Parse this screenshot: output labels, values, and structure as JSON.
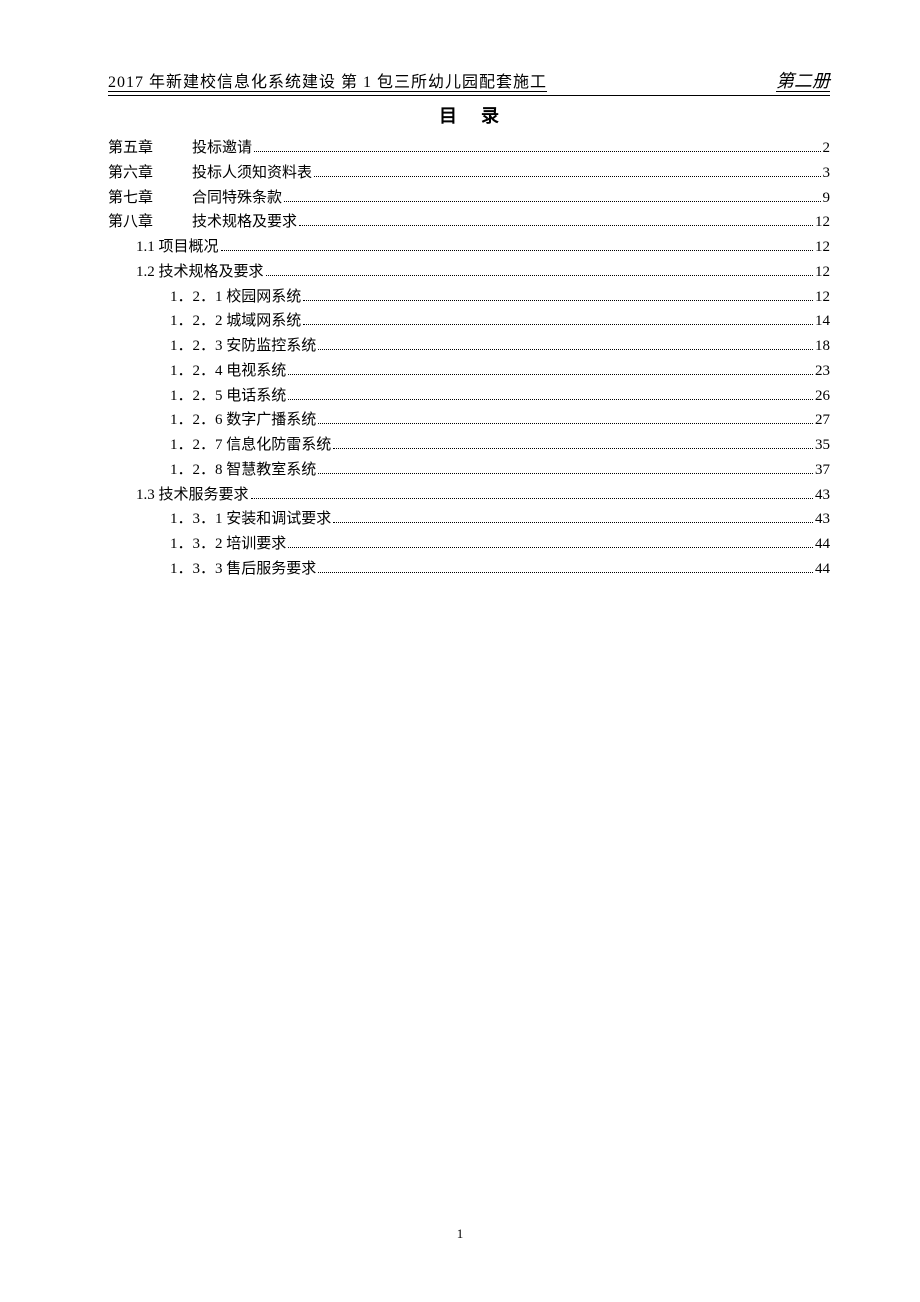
{
  "header": {
    "left": "2017 年新建校信息化系统建设  第 1 包三所幼儿园配套施工",
    "right": "第二册"
  },
  "title": "目录",
  "toc": [
    {
      "chapter": "第五章",
      "text": "投标邀请",
      "page": "2",
      "indent": 0,
      "hasChapter": true
    },
    {
      "chapter": "第六章",
      "text": "投标人须知资料表",
      "page": "3",
      "indent": 0,
      "hasChapter": true
    },
    {
      "chapter": "第七章",
      "text": "合同特殊条款",
      "page": "9",
      "indent": 0,
      "hasChapter": true
    },
    {
      "chapter": "第八章",
      "text": "技术规格及要求",
      "page": "12",
      "indent": 0,
      "hasChapter": true
    },
    {
      "chapter": "",
      "text": "1.1 项目概况",
      "page": "12",
      "indent": 1,
      "hasChapter": false
    },
    {
      "chapter": "",
      "text": "1.2 技术规格及要求",
      "page": "12",
      "indent": 1,
      "hasChapter": false
    },
    {
      "chapter": "",
      "text": "1．2．1 校园网系统",
      "page": "12",
      "indent": 2,
      "hasChapter": false
    },
    {
      "chapter": "",
      "text": "1．2．2 城域网系统",
      "page": "14",
      "indent": 2,
      "hasChapter": false
    },
    {
      "chapter": "",
      "text": "1．2．3 安防监控系统",
      "page": "18",
      "indent": 2,
      "hasChapter": false
    },
    {
      "chapter": "",
      "text": "1．2．4 电视系统",
      "page": "23",
      "indent": 2,
      "hasChapter": false
    },
    {
      "chapter": "",
      "text": "1．2．5 电话系统",
      "page": "26",
      "indent": 2,
      "hasChapter": false
    },
    {
      "chapter": "",
      "text": "1．2．6 数字广播系统",
      "page": "27",
      "indent": 2,
      "hasChapter": false
    },
    {
      "chapter": "",
      "text": "1．2．7 信息化防雷系统",
      "page": "35",
      "indent": 2,
      "hasChapter": false
    },
    {
      "chapter": "",
      "text": "1．2．8 智慧教室系统",
      "page": "37",
      "indent": 2,
      "hasChapter": false
    },
    {
      "chapter": "",
      "text": "1.3 技术服务要求",
      "page": "43",
      "indent": 1,
      "hasChapter": false
    },
    {
      "chapter": "",
      "text": "1．3．1 安装和调试要求",
      "page": "43",
      "indent": 2,
      "hasChapter": false
    },
    {
      "chapter": "",
      "text": "1．3．2 培训要求",
      "page": "44",
      "indent": 2,
      "hasChapter": false
    },
    {
      "chapter": "",
      "text": "1．3．3 售后服务要求",
      "page": "44",
      "indent": 2,
      "hasChapter": false
    }
  ],
  "pageNumber": "1"
}
